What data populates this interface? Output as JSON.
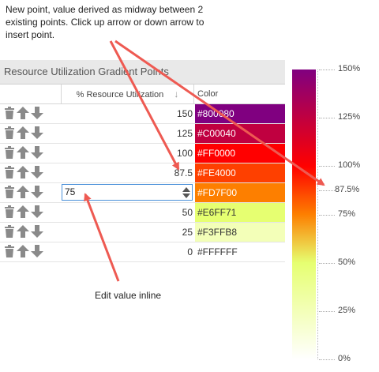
{
  "annotations": {
    "new_point": "New point, value derived as midway between 2 existing points. Click up arrow or down arrow to insert point.",
    "edit_inline": "Edit value inline"
  },
  "panel": {
    "title": "Resource Utilization Gradient Points",
    "columns": {
      "percent": "% Resource Utilization",
      "color": "Color"
    }
  },
  "rows": [
    {
      "value": "150",
      "color": "#800080",
      "text_color": "#ffffff"
    },
    {
      "value": "125",
      "color": "#C00040",
      "text_color": "#ffffff"
    },
    {
      "value": "100",
      "color": "#FF0000",
      "text_color": "#ffffff"
    },
    {
      "value": "87.5",
      "color": "#FE4000",
      "text_color": "#ffffff"
    },
    {
      "value": "75",
      "color": "#FD7F00",
      "text_color": "#ffffff",
      "editing": true
    },
    {
      "value": "50",
      "color": "#E6FF71",
      "text_color": "#333333"
    },
    {
      "value": "25",
      "color": "#F3FFB8",
      "text_color": "#333333"
    },
    {
      "value": "0",
      "color": "#FFFFFF",
      "text_color": "#333333"
    }
  ],
  "scale": {
    "ticks": [
      "150%",
      "125%",
      "100%",
      "87.5%",
      "75%",
      "50%",
      "25%",
      "0%"
    ]
  },
  "accent_colors": {
    "annotation_arrow": "#ee5a52",
    "input_border": "#4a90d9"
  }
}
